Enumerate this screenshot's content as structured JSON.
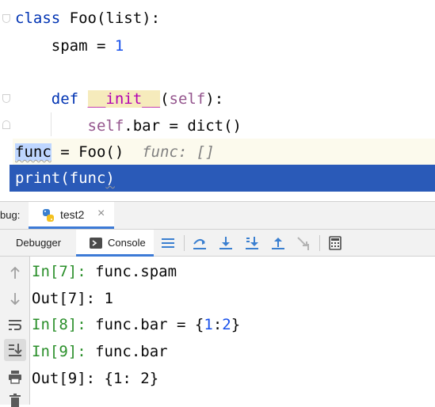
{
  "editor": {
    "lines": [
      {
        "t1": "class",
        "t2": " Foo(list):"
      },
      {
        "indent": "    ",
        "name": "spam",
        "op": " = ",
        "num": "1"
      },
      {},
      {
        "indent": "    ",
        "kw": "def",
        "sp": " ",
        "dunder": "__init__",
        "lp": "(",
        "self": "self",
        "rp": "):"
      },
      {
        "indent": "        ",
        "self": "self",
        "rest": ".bar = dict()"
      },
      {
        "var": "func",
        "rest": " = Foo()",
        "hint": "  func: []"
      },
      {
        "fn": "print",
        "lp": "(",
        "arg": "func",
        "rp": ")"
      }
    ]
  },
  "debug": {
    "label": "bug:",
    "tab_name": "test2",
    "tab_close": "×",
    "toolbar": {
      "debugger_label": "Debugger",
      "console_label": "Console"
    }
  },
  "console": {
    "lines": [
      {
        "prompt": "In[7]:",
        "code": " func.spam"
      },
      {
        "out": "Out[7]:",
        "val": " 1"
      },
      {
        "prompt": "In[8]:",
        "code": " func.bar = {",
        "n1": "1",
        "colon": ":",
        "n2": "2",
        "close": "}"
      },
      {
        "prompt": "In[9]:",
        "code": " func.bar"
      },
      {
        "out": "Out[9]:",
        "val": " {1: 2}"
      }
    ]
  },
  "icons": {
    "tab_icon": "python-icon",
    "side": [
      "up-arrow-icon",
      "down-arrow-icon",
      "soft-wrap-icon",
      "scroll-to-end-icon",
      "print-icon",
      "delete-icon"
    ],
    "toolbar": [
      "console-icon",
      "threads-icon",
      "step-over-icon",
      "step-into-icon",
      "step-into-my-code-icon",
      "step-out-icon",
      "run-to-cursor-icon",
      "evaluate-icon"
    ]
  },
  "colors": {
    "selection": "#2a5ab8",
    "keyword": "#0033b3",
    "number": "#1750eb",
    "prompt": "#2a8f2a",
    "toolbar_icon": "#3a7fd0"
  }
}
